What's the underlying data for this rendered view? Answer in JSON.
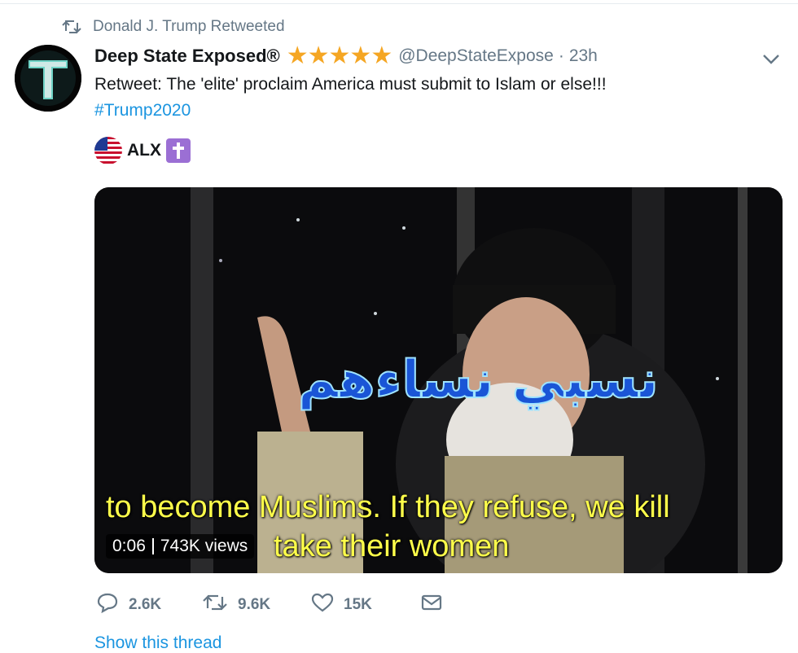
{
  "retweet_context": {
    "icon": "retweet-icon",
    "text": "Donald J. Trump Retweeted"
  },
  "tweet": {
    "avatar": "avatar-letter-T",
    "display_name": "Deep State Exposed®",
    "stars": "★★★★★",
    "handle": "@DeepStateExpose",
    "separator": "·",
    "time": "23h",
    "text": "Retweet: The 'elite' proclaim America must submit to Islam or else!!!",
    "hashtag": "#Trump2020"
  },
  "quoted_user": {
    "avatar": "us-flag-avatar",
    "name": "ALX"
  },
  "media": {
    "arabic_caption": "نسبي نساءهم",
    "subtitle_line1": "to become Muslims.  If they refuse, we kill",
    "subtitle_line2": "take their women",
    "duration": "0:06",
    "views": "743K views"
  },
  "actions": {
    "replies": "2.6K",
    "retweets": "9.6K",
    "likes": "15K"
  },
  "show_thread": "Show this thread",
  "colors": {
    "link": "#1b95e0",
    "muted": "#657786",
    "star": "#f5a623",
    "subtitle": "#ffff4a"
  }
}
